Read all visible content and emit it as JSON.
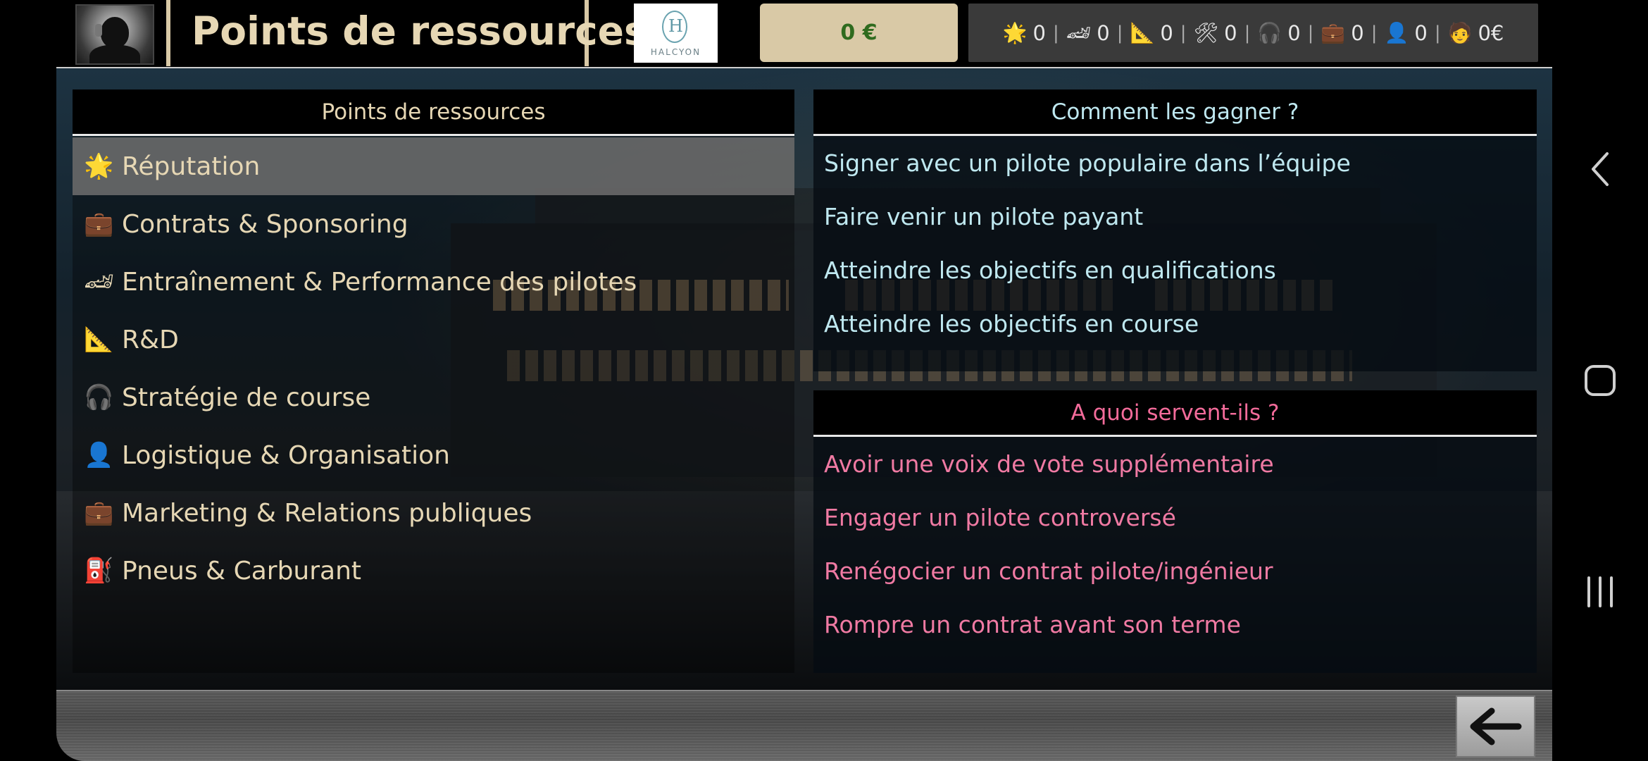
{
  "header": {
    "title": "Points de ressources",
    "team_logo_mark": "H",
    "team_logo_name": "HALCYON",
    "money": "0 €",
    "resources": [
      {
        "icon": "star-icon",
        "glyph": "🌟",
        "value": "0"
      },
      {
        "icon": "race-car-icon",
        "glyph": "🏎",
        "value": "0"
      },
      {
        "icon": "set-square-icon",
        "glyph": "📐",
        "value": "0"
      },
      {
        "icon": "tools-icon",
        "glyph": "🛠",
        "value": "0"
      },
      {
        "icon": "headphones-icon",
        "glyph": "🎧",
        "value": "0"
      },
      {
        "icon": "briefcase-icon",
        "glyph": "💼",
        "value": "0"
      },
      {
        "icon": "person-icon",
        "glyph": "👤",
        "value": "0"
      },
      {
        "icon": "driver-face-icon",
        "glyph": "🧑",
        "value": "0€"
      }
    ]
  },
  "left_panel": {
    "header": "Points de ressources",
    "items": [
      {
        "icon": "star-icon",
        "glyph": "🌟",
        "label": "Réputation",
        "selected": true
      },
      {
        "icon": "briefcase-icon",
        "glyph": "💼",
        "label": "Contrats & Sponsoring",
        "selected": false
      },
      {
        "icon": "race-car-icon",
        "glyph": "🏎",
        "label": "Entraînement & Performance des pilotes",
        "selected": false
      },
      {
        "icon": "set-square-icon",
        "glyph": "📐",
        "label": "R&D",
        "selected": false
      },
      {
        "icon": "headphones-icon",
        "glyph": "🎧",
        "label": "Stratégie de course",
        "selected": false
      },
      {
        "icon": "person-icon",
        "glyph": "👤",
        "label": "Logistique & Organisation",
        "selected": false
      },
      {
        "icon": "briefcase-icon",
        "glyph": "💼",
        "label": "Marketing & Relations publiques",
        "selected": false
      },
      {
        "icon": "fuel-pump-icon",
        "glyph": "⛽",
        "label": "Pneus & Carburant",
        "selected": false
      }
    ]
  },
  "earn_panel": {
    "header": "Comment les gagner ?",
    "items": [
      "Signer avec un pilote populaire dans l’équipe",
      "Faire venir un pilote payant",
      "Atteindre les objectifs en qualifications",
      "Atteindre les objectifs en course"
    ]
  },
  "use_panel": {
    "header": "A quoi servent-ils ?",
    "items": [
      "Avoir une voix de vote supplémentaire",
      "Engager un pilote controversé",
      "Renégocier un contrat pilote/ingénieur",
      "Rompre un contrat avant son terme"
    ]
  },
  "footer": {
    "back_icon": "arrow-left-icon"
  },
  "navbar": {
    "back_icon": "chevron-left-icon",
    "home_icon": "square-home-icon",
    "recents_icon": "recents-icon"
  }
}
